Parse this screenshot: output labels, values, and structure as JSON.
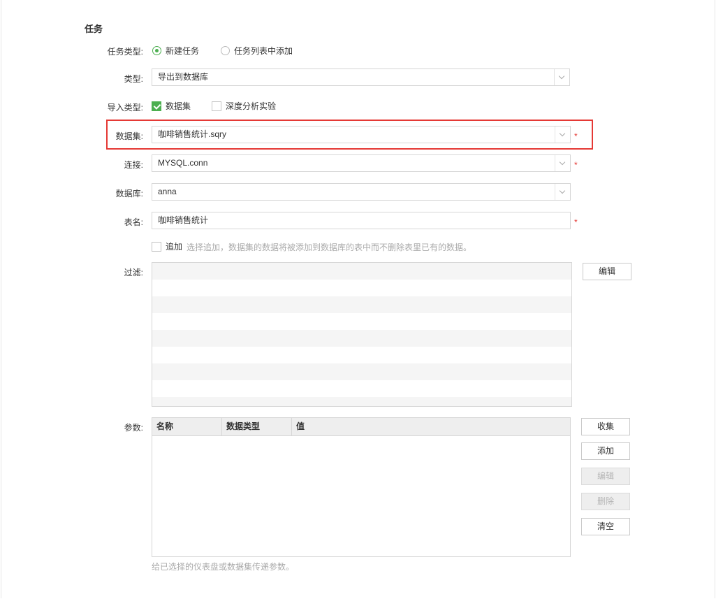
{
  "section_title": "任务",
  "task_type": {
    "label": "任务类型:",
    "options": [
      {
        "label": "新建任务",
        "selected": true
      },
      {
        "label": "任务列表中添加",
        "selected": false
      }
    ]
  },
  "type": {
    "label": "类型:",
    "value": "导出到数据库"
  },
  "import_type": {
    "label": "导入类型:",
    "options": [
      {
        "label": "数据集",
        "checked": true
      },
      {
        "label": "深度分析实验",
        "checked": false
      }
    ]
  },
  "dataset": {
    "label": "数据集:",
    "value": "咖啡销售统计.sqry",
    "required": "*"
  },
  "connection": {
    "label": "连接:",
    "value": "MYSQL.conn",
    "required": "*"
  },
  "database": {
    "label": "数据库:",
    "value": "anna"
  },
  "table_name": {
    "label": "表名:",
    "value": "咖啡销售统计",
    "required": "*"
  },
  "append": {
    "label": "追加",
    "checked": false,
    "hint": "选择追加，数据集的数据将被添加到数据库的表中而不删除表里已有的数据。"
  },
  "filter": {
    "label": "过滤:",
    "edit_button": "编辑"
  },
  "params": {
    "label": "参数:",
    "columns": [
      "名称",
      "数据类型",
      "值"
    ],
    "rows": [],
    "buttons": {
      "collect": "收集",
      "add": "添加",
      "edit": "编辑",
      "delete": "删除",
      "clear": "清空"
    },
    "hint": "给已选择的仪表盘或数据集传递参数。"
  },
  "colors": {
    "accent_green": "#4caf50",
    "required_red": "#e53935",
    "highlight_red": "#e53935"
  }
}
